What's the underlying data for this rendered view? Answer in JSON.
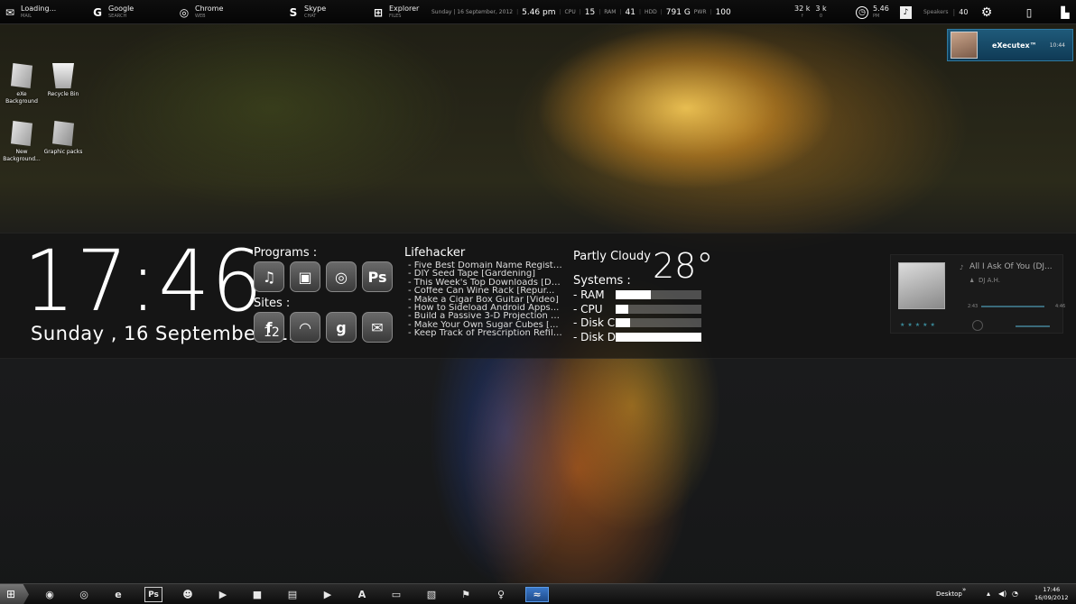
{
  "topbar": {
    "mail": {
      "main": "Loading...",
      "sub": "MAIL",
      "icon": "mail-icon"
    },
    "google": {
      "main": "Google",
      "sub": "SEARCH",
      "icon": "google-icon"
    },
    "chrome": {
      "main": "Chrome",
      "sub": "WEB",
      "icon": "chrome-icon"
    },
    "skype": {
      "main": "Skype",
      "sub": "CHAT",
      "icon": "skype-icon"
    },
    "explorer": {
      "main": "Explorer",
      "sub": "FILES",
      "icon": "windows-icon"
    },
    "date_text": "Sunday  |  16 September, 2012",
    "time": "5.46 pm",
    "cpu_label": "CPU",
    "cpu_value": "15",
    "ram_label": "RAM",
    "ram_value": "41",
    "hdd_label": "HDD",
    "hdd_value": "791 G",
    "pwr_label": "PWR",
    "pwr_value": "100",
    "net_up": "32 k",
    "net_down": "3 k",
    "net_up_sub": "↑",
    "net_down_sub": "0",
    "clock_main": "5.46",
    "clock_sub": "PM",
    "speakers_label": "Speakers",
    "speakers_value": "40"
  },
  "notification": {
    "name": "eXecutex™",
    "time": "10:44"
  },
  "desktop_icons": [
    {
      "label": "eXe\nBackground"
    },
    {
      "label": "Recycle Bin"
    },
    {
      "label": "New\nBackground..."
    },
    {
      "label": "Graphic packs"
    }
  ],
  "clock": {
    "time": "17:46",
    "date": "Sunday , 16 September '12"
  },
  "programs": {
    "label": "Programs :",
    "items": [
      "♫",
      "▣",
      "◎",
      "Ps"
    ]
  },
  "sites": {
    "label": "Sites :",
    "items": [
      "f",
      "◠",
      "g",
      "✉"
    ],
    "badge": "12"
  },
  "lifehacker": {
    "title": "Lifehacker",
    "items": [
      "- Five Best Domain Name Registr...",
      "- DIY Seed Tape [Gardening]",
      "- This Week's Top Downloads [Do...",
      "- Coffee Can Wine Rack [Repur...",
      "- Make a Cigar Box Guitar [Video]",
      "- How to Sideload Android Apps...",
      "- Build a Passive 3-D Projection S...",
      "- Make Your Own Sugar Cubes [...",
      "- Keep Track of Prescription Refill..."
    ]
  },
  "weather": {
    "condition": "Partly Cloudy",
    "temp": "28°"
  },
  "systems": {
    "label": "Systems :",
    "rows": [
      {
        "name": "- RAM",
        "fill": 0.41
      },
      {
        "name": "- CPU",
        "fill": 0.15
      },
      {
        "name": "- Disk C",
        "fill": 0.17
      },
      {
        "name": "- Disk D",
        "fill": 1.0
      }
    ]
  },
  "player": {
    "song": "All I Ask Of You (DJ...",
    "artist": "DJ A.H.",
    "elapsed": "2:43",
    "total": "4:46",
    "stars": "★★★★★"
  },
  "taskbar": {
    "items": [
      "◉",
      "◎",
      "e",
      "Ps",
      "☻",
      "▶",
      "■",
      "▤",
      "▶",
      "A",
      "▭",
      "▧",
      "⚑",
      "♀",
      "≈"
    ],
    "desktop_label": "Desktop",
    "clock_time": "17:46",
    "clock_date": "16/09/2012"
  }
}
